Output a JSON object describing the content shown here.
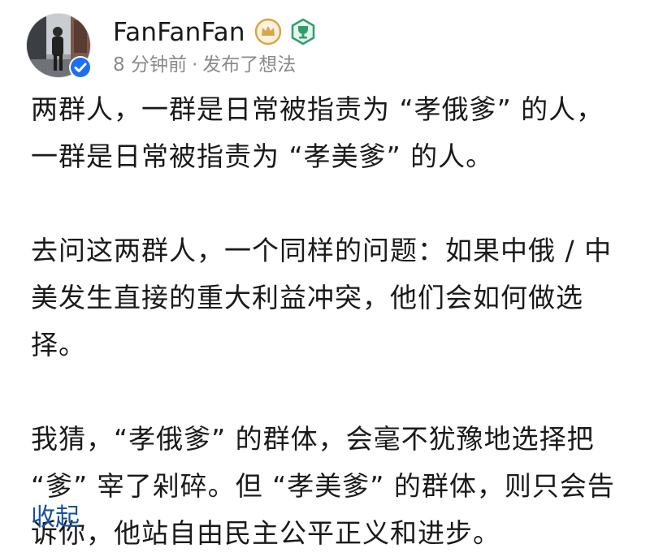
{
  "post": {
    "author": "FanFanFan",
    "time": "8 分钟前",
    "separator": "·",
    "action": "发布了想法",
    "paragraphs": [
      "两群人，一群是日常被指责为 “孝俄爹” 的人，一群是日常被指责为 “孝美爹” 的人。",
      "去问这两群人，一个同样的问题：如果中俄 / 中美发生直接的重大利益冲突，他们会如何做选择。",
      "我猜，“孝俄爹” 的群体，会毫不犹豫地选择把 “爹” 宰了剁碎。但 “孝美爹” 的群体，则只会告诉你，他站自由民主公平正义和进步。"
    ],
    "collapse_label": "收起"
  },
  "icons": {
    "verified": "verified-check-icon",
    "crown_badge": "crown-badge-icon",
    "trophy_badge": "trophy-badge-icon"
  },
  "colors": {
    "verified_blue": "#1e6ef5",
    "crown_gold": "#d7a64a",
    "trophy_green": "#2f9e6e",
    "meta_gray": "#8a8a8a",
    "link_blue": "#175199"
  }
}
